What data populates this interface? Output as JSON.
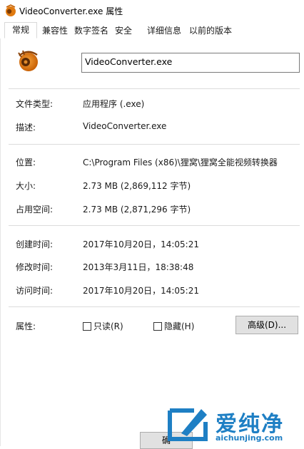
{
  "window": {
    "title": "VideoConverter.exe 属性"
  },
  "tabs": [
    {
      "label": "常规",
      "active": true
    },
    {
      "label": "兼容性",
      "active": false
    },
    {
      "label": "数字签名",
      "active": false
    },
    {
      "label": "安全",
      "active": false
    },
    {
      "label": "详细信息",
      "active": false
    },
    {
      "label": "以前的版本",
      "active": false
    }
  ],
  "general": {
    "file_name": "VideoConverter.exe",
    "file_type_label": "文件类型:",
    "file_type_value": "应用程序 (.exe)",
    "description_label": "描述:",
    "description_value": "VideoConverter.exe",
    "location_label": "位置:",
    "location_value": "C:\\Program Files (x86)\\狸窝\\狸窝全能视频转换器",
    "size_label": "大小:",
    "size_value": "2.73 MB (2,869,112 字节)",
    "size_on_disk_label": "占用空间:",
    "size_on_disk_value": "2.73 MB (2,871,296 字节)",
    "created_label": "创建时间:",
    "created_value": "2017年10月20日，14:05:21",
    "modified_label": "修改时间:",
    "modified_value": "2013年3月11日，18:38:48",
    "accessed_label": "访问时间:",
    "accessed_value": "2017年10月20日，14:05:21",
    "attributes_label": "属性:",
    "readonly_label": "只读(R)",
    "readonly_checked": false,
    "hidden_label": "隐藏(H)",
    "hidden_checked": false,
    "advanced_button": "高级(D)..."
  },
  "footer": {
    "ok_button": "确"
  },
  "watermark": {
    "brand": "爱纯净",
    "url": "aichunjing.com"
  },
  "colors": {
    "watermark_blue": "#1e7fc4",
    "icon_orange": "#e07a10"
  }
}
